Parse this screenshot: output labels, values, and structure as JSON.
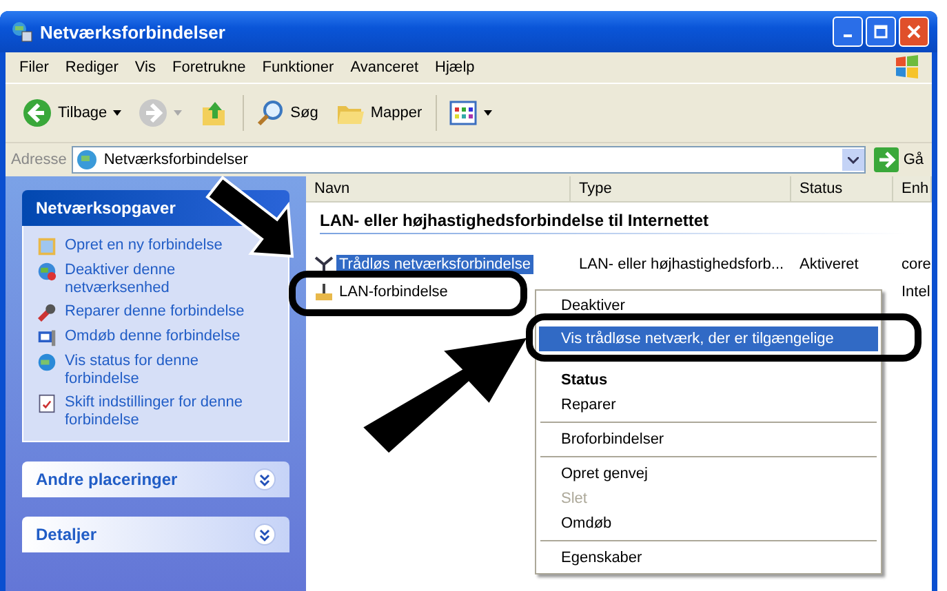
{
  "window": {
    "title": "Netværksforbindelser"
  },
  "menu": [
    "Filer",
    "Rediger",
    "Vis",
    "Foretrukne",
    "Funktioner",
    "Avanceret",
    "Hjælp"
  ],
  "toolbar": [
    {
      "kind": "back",
      "label": "Tilbage"
    },
    {
      "kind": "forward"
    },
    {
      "kind": "up"
    },
    {
      "kind": "search",
      "label": "Søg"
    },
    {
      "kind": "folders",
      "label": "Mapper"
    },
    {
      "kind": "views"
    }
  ],
  "address": {
    "label": "Adresse",
    "value": "Netværksforbindelser",
    "go": "Gå"
  },
  "sidebar": [
    {
      "title": "Netværksopgaver",
      "expanded": true,
      "items": [
        {
          "kind": "new",
          "label": "Opret en ny forbindelse"
        },
        {
          "kind": "disable",
          "label": "Deaktiver denne netværksenhed"
        },
        {
          "kind": "repair",
          "label": "Reparer denne forbindelse"
        },
        {
          "kind": "rename",
          "label": "Omdøb denne forbindelse"
        },
        {
          "kind": "status",
          "label": "Vis status for denne forbindelse"
        },
        {
          "kind": "settings",
          "label": "Skift indstillinger for denne forbindelse"
        }
      ]
    },
    {
      "title": "Andre placeringer",
      "expanded": false
    },
    {
      "title": "Detaljer",
      "expanded": false
    }
  ],
  "columns": [
    "Navn",
    "Type",
    "Status",
    "Enh"
  ],
  "group_header": "LAN- eller højhastighedsforbindelse til Internettet",
  "rows": [
    {
      "kind": "wireless",
      "name": "Trådløs netværksforbindelse",
      "type": "LAN- eller højhastighedsforb...",
      "status": "Aktiveret",
      "device": "core",
      "selected": true
    },
    {
      "kind": "lan",
      "name": "LAN-forbindelse",
      "device": "Intel",
      "selected": false
    }
  ],
  "context_menu": [
    {
      "kind": "item",
      "label": "Deaktiver",
      "selected": false,
      "disabled": false,
      "default": false
    },
    {
      "kind": "item",
      "label": "Vis trådløse netværk, der er tilgængelige",
      "selected": true,
      "disabled": false,
      "default": false
    },
    {
      "kind": "item",
      "label": "Status",
      "selected": false,
      "disabled": false,
      "default": true
    },
    {
      "kind": "item",
      "label": "Reparer",
      "selected": false,
      "disabled": false,
      "default": false
    },
    {
      "kind": "separator"
    },
    {
      "kind": "item",
      "label": "Broforbindelser",
      "selected": false,
      "disabled": false,
      "default": false
    },
    {
      "kind": "separator"
    },
    {
      "kind": "item",
      "label": "Opret genvej",
      "selected": false,
      "disabled": false,
      "default": false
    },
    {
      "kind": "item",
      "label": "Slet",
      "selected": false,
      "disabled": true,
      "default": false
    },
    {
      "kind": "item",
      "label": "Omdøb",
      "selected": false,
      "disabled": false,
      "default": false
    },
    {
      "kind": "separator"
    },
    {
      "kind": "item",
      "label": "Egenskaber",
      "selected": false,
      "disabled": false,
      "default": false
    }
  ]
}
